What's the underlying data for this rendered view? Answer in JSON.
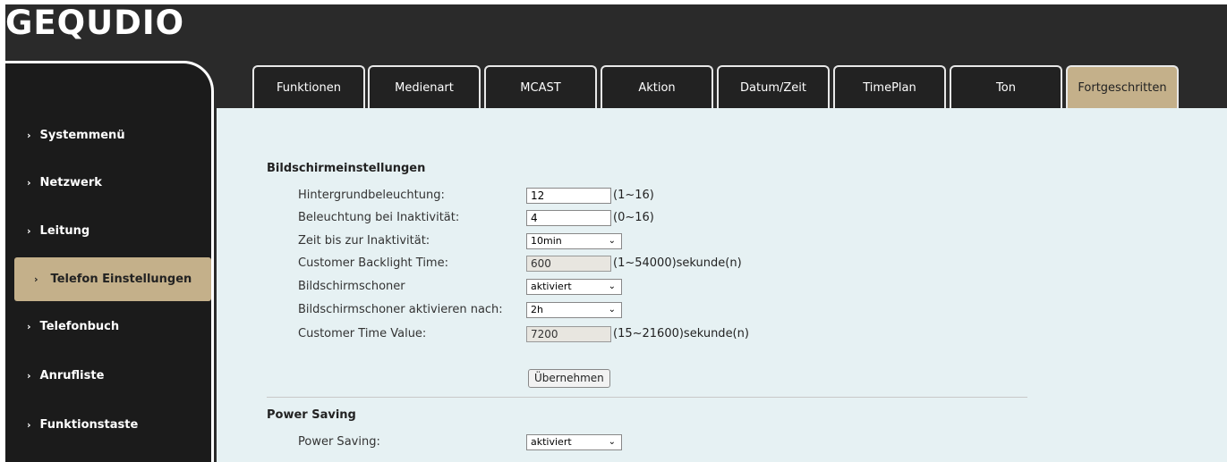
{
  "brand": {
    "logo": "GEQUDIO"
  },
  "sidebar": {
    "items": [
      {
        "label": "Systemmenü"
      },
      {
        "label": "Netzwerk"
      },
      {
        "label": "Leitung"
      },
      {
        "label": "Telefon Einstellungen"
      },
      {
        "label": "Telefonbuch"
      },
      {
        "label": "Anrufliste"
      },
      {
        "label": "Funktionstaste"
      }
    ],
    "active": "Telefon Einstellungen",
    "chevron": "›"
  },
  "tabs": [
    {
      "label": "Funktionen"
    },
    {
      "label": "Medienart"
    },
    {
      "label": "MCAST"
    },
    {
      "label": "Aktion"
    },
    {
      "label": "Datum/Zeit"
    },
    {
      "label": "TimePlan"
    },
    {
      "label": "Ton"
    },
    {
      "label": "Fortgeschritten"
    }
  ],
  "active_tab": "Fortgeschritten",
  "display_settings": {
    "title": "Bildschirmeinstellungen",
    "rows": [
      {
        "label": "Hintergrundbeleuchtung:",
        "value": "12",
        "hint": "(1~16)"
      },
      {
        "label": "Beleuchtung bei Inaktivität:",
        "value": "4",
        "hint": "(0~16)"
      },
      {
        "label": "Zeit bis zur Inaktivität:",
        "value": "10min"
      },
      {
        "label": "Customer Backlight Time:",
        "value": "600",
        "hint": "(1~54000)sekunde(n)"
      },
      {
        "label": "Bildschirmschoner",
        "value": "aktiviert"
      },
      {
        "label": "Bildschirmschoner aktivieren nach:",
        "value": "2h"
      },
      {
        "label": "Customer Time Value:",
        "value": "7200",
        "hint": "(15~21600)sekunde(n)"
      }
    ],
    "apply_label": "Übernehmen"
  },
  "power_saving": {
    "title": "Power Saving",
    "rows": [
      {
        "label": "Power Saving:",
        "value": "aktiviert"
      }
    ]
  },
  "icons": {
    "dropdown": "chevron-down-icon",
    "nav": "chevron-right-icon"
  },
  "colors": {
    "accent": "#c4b08a",
    "frame": "#2a2a2a",
    "sidebar": "#1b1b1b",
    "content_bg": "#e6f1f3"
  }
}
